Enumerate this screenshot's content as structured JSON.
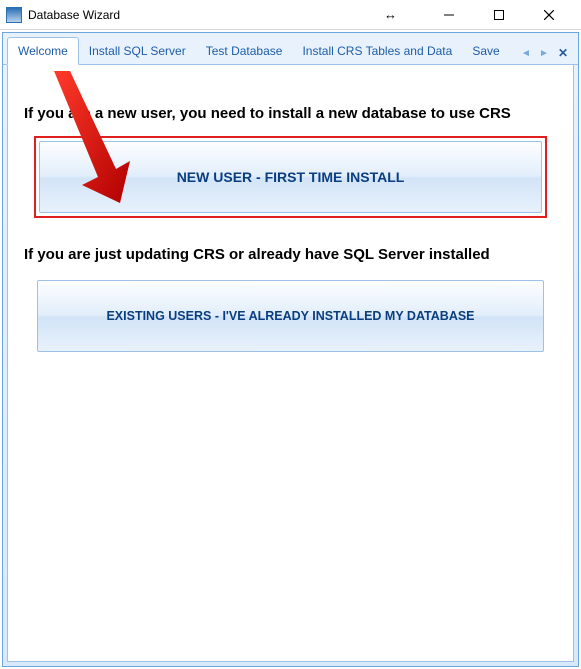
{
  "window": {
    "title": "Database Wizard"
  },
  "tabs": {
    "items": [
      {
        "label": "Welcome"
      },
      {
        "label": "Install SQL Server"
      },
      {
        "label": "Test Database"
      },
      {
        "label": "Install CRS Tables and Data"
      },
      {
        "label": "Save"
      }
    ]
  },
  "main": {
    "heading_new": "If you are a new user, you need to install a new database to use CRS",
    "button_new": "NEW USER - FIRST TIME INSTALL",
    "heading_existing": "If you are just updating CRS or already have SQL Server installed",
    "button_existing": "EXISTING USERS - I'VE ALREADY INSTALLED MY DATABASE"
  }
}
